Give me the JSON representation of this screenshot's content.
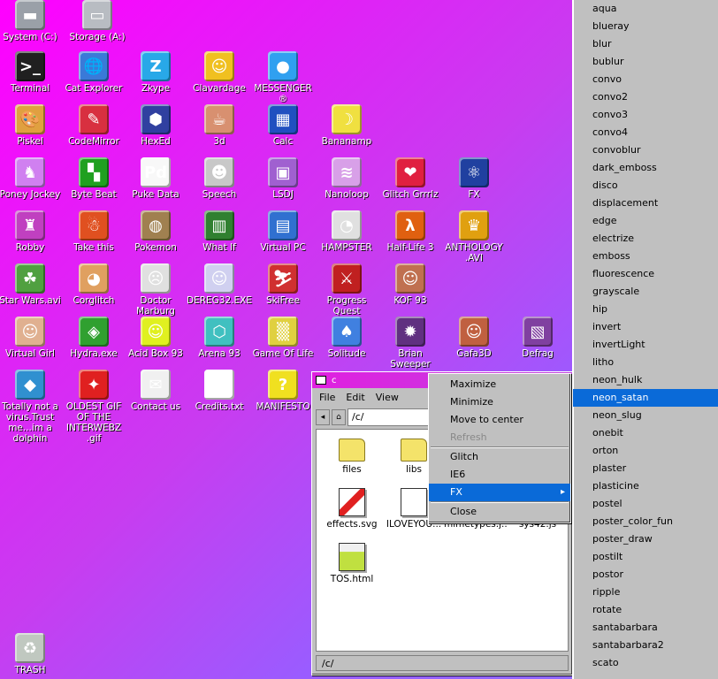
{
  "desktop_icons": [
    {
      "label": "System (C:)",
      "glyph": "▬",
      "color": "#9aa0a8"
    },
    {
      "label": "Storage (A:)",
      "glyph": "▭",
      "color": "#b8bcc2"
    },
    {
      "label": "Terminal",
      "glyph": ">_",
      "color": "#202020"
    },
    {
      "label": "Cat Explorer",
      "glyph": "🌐",
      "color": "#3a7ad8"
    },
    {
      "label": "Zkype",
      "glyph": "Z",
      "color": "#28a8e8"
    },
    {
      "label": "Clavardage",
      "glyph": "☺",
      "color": "#f0c020"
    },
    {
      "label": "MESSENGER ®",
      "glyph": "●",
      "color": "#30a0f0"
    },
    {
      "label": "Piskel",
      "glyph": "🎨",
      "color": "#e0a040"
    },
    {
      "label": "CodeMirror",
      "glyph": "✎",
      "color": "#d83040"
    },
    {
      "label": "HexEd",
      "glyph": "⬢",
      "color": "#3040a0"
    },
    {
      "label": "3d",
      "glyph": "☕",
      "color": "#d89070"
    },
    {
      "label": "Calc",
      "glyph": "▦",
      "color": "#2050c0"
    },
    {
      "label": "Bananamp",
      "glyph": "☽",
      "color": "#f0e040"
    },
    {
      "label": "Poney Jockey",
      "glyph": "♞",
      "color": "#d080f0"
    },
    {
      "label": "Byte Beat",
      "glyph": "▚",
      "color": "#20a020"
    },
    {
      "label": "Puke Data",
      "glyph": "Pd",
      "color": "#f8f8f8"
    },
    {
      "label": "Speech",
      "glyph": "☻",
      "color": "#c8c8c8"
    },
    {
      "label": "LSDJ",
      "glyph": "▣",
      "color": "#a060d0"
    },
    {
      "label": "Nanoloop",
      "glyph": "≋",
      "color": "#d8a0e8"
    },
    {
      "label": "Glitch Grrrlz",
      "glyph": "❤",
      "color": "#e02040"
    },
    {
      "label": "FX",
      "glyph": "⚛",
      "color": "#2040a0"
    },
    {
      "label": "Robby",
      "glyph": "♜",
      "color": "#c040c0"
    },
    {
      "label": "Take this",
      "glyph": "☃",
      "color": "#e05020"
    },
    {
      "label": "Pokemon",
      "glyph": "◍",
      "color": "#a08050"
    },
    {
      "label": "What If",
      "glyph": "▥",
      "color": "#308030"
    },
    {
      "label": "Virtual PC",
      "glyph": "▤",
      "color": "#3070d0"
    },
    {
      "label": "HAMPSTER",
      "glyph": "◔",
      "color": "#e0e0e0"
    },
    {
      "label": "Half-Life 3",
      "glyph": "λ",
      "color": "#e06010"
    },
    {
      "label": "ANTHOLOGY .AVI",
      "glyph": "♛",
      "color": "#e0a010"
    },
    {
      "label": "Star Wars.avi",
      "glyph": "☘",
      "color": "#50a040"
    },
    {
      "label": "Corglitch",
      "glyph": "◕",
      "color": "#e0a060"
    },
    {
      "label": "Doctor Marburg",
      "glyph": "☹",
      "color": "#e0e0e0"
    },
    {
      "label": "DEREG32.EXE",
      "glyph": "☺",
      "color": "#d0d0f0"
    },
    {
      "label": "SkiFree",
      "glyph": "⛷",
      "color": "#d03030"
    },
    {
      "label": "Progress Quest",
      "glyph": "⚔",
      "color": "#c02020"
    },
    {
      "label": "KOF 93",
      "glyph": "☺",
      "color": "#c07050"
    },
    {
      "label": "Virtual Girl",
      "glyph": "☺",
      "color": "#e0b090"
    },
    {
      "label": "Hydra.exe",
      "glyph": "◈",
      "color": "#30a030"
    },
    {
      "label": "Acid Box 93",
      "glyph": "☺",
      "color": "#e0f020"
    },
    {
      "label": "Arena 93",
      "glyph": "⬡",
      "color": "#40c0c0"
    },
    {
      "label": "Game Of Life",
      "glyph": "▒",
      "color": "#e0d040"
    },
    {
      "label": "Solitude",
      "glyph": "♠",
      "color": "#4080e0"
    },
    {
      "label": "Brian Sweeper",
      "glyph": "✹",
      "color": "#603080"
    },
    {
      "label": "Gafa3D",
      "glyph": "☺",
      "color": "#c06040"
    },
    {
      "label": "Defrag",
      "glyph": "▧",
      "color": "#8040a0"
    },
    {
      "label": "Totally not a virus.Trust me...im a dolphin",
      "glyph": "◆",
      "color": "#3090d0"
    },
    {
      "label": "OLDEST GIF OF THE INTERWEBZ .gif",
      "glyph": "✦",
      "color": "#e02020"
    },
    {
      "label": "Contact us",
      "glyph": "✉",
      "color": "#f0f0f0"
    },
    {
      "label": "Credits.txt",
      "glyph": "≣",
      "color": "#ffffff"
    },
    {
      "label": "MANIFESTO",
      "glyph": "?",
      "color": "#f0e020"
    },
    {
      "label": "TRASH",
      "glyph": "♻",
      "color": "#c0c8c0"
    }
  ],
  "window": {
    "title": "c",
    "menus": [
      "File",
      "Edit",
      "View"
    ],
    "address": "/c/",
    "status": "/c/",
    "files": [
      {
        "name": "files",
        "kind": "folder"
      },
      {
        "name": "libs",
        "kind": "folder"
      },
      {
        "name": "effects.svg",
        "kind": "svg"
      },
      {
        "name": "ILOVEYOU...",
        "kind": "doc"
      },
      {
        "name": "mimetypes.j...",
        "kind": "doc"
      },
      {
        "name": "sys42.js",
        "kind": "doc"
      },
      {
        "name": "TOS.html",
        "kind": "html"
      }
    ]
  },
  "context_menu": {
    "items": [
      "Maximize",
      "Minimize",
      "Move to center",
      "Refresh",
      "Glitch",
      "IE6",
      "FX",
      "Close"
    ],
    "disabled": [
      "Refresh"
    ],
    "selected": "FX"
  },
  "fx_submenu": {
    "items": [
      "...",
      "aqua",
      "blueray",
      "blur",
      "bublur",
      "convo",
      "convo2",
      "convo3",
      "convo4",
      "convoblur",
      "dark_emboss",
      "disco",
      "displacement",
      "edge",
      "electrize",
      "emboss",
      "fluorescence",
      "grayscale",
      "hip",
      "invert",
      "invertLight",
      "litho",
      "neon_hulk",
      "neon_satan",
      "neon_slug",
      "onebit",
      "orton",
      "plaster",
      "plasticine",
      "postel",
      "poster_color_fun",
      "poster_draw",
      "postilt",
      "postor",
      "ripple",
      "rotate",
      "santabarbara",
      "santabarbara2",
      "scato"
    ],
    "selected": "neon_satan"
  }
}
